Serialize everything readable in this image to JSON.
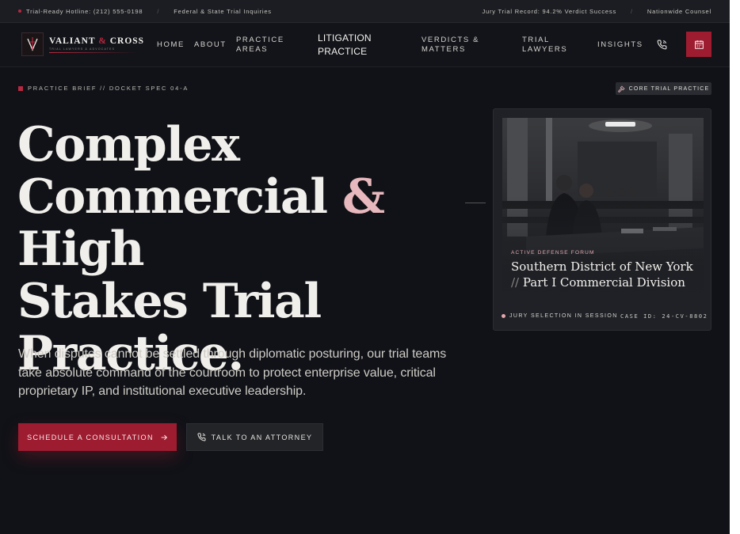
{
  "topbar": {
    "hotline": "Trial-Ready Hotline: (212) 555-0198",
    "inquiries": "Federal & State Trial Inquiries",
    "record": "Jury Trial Record: 94.2% Verdict Success",
    "counsel": "Nationwide Counsel",
    "separator": "/"
  },
  "brand": {
    "name_a": "VALIANT",
    "amp": " & ",
    "name_b": "CROSS",
    "tagline": "TRIAL LAWYERS & ADVOCATES"
  },
  "nav": {
    "home": "HOME",
    "about": "ABOUT",
    "practice_1": "PRACTICE",
    "practice_2": "AREAS",
    "litigation_1": "LITIGATION",
    "litigation_2": "PRACTICE",
    "verdicts_1": "VERDICTS &",
    "verdicts_2": "MATTERS",
    "lawyers_1": "TRIAL",
    "lawyers_2": "LAWYERS",
    "insights": "INSIGHTS",
    "phone_icon": "phone-icon",
    "calendar_icon": "calendar-icon"
  },
  "hero": {
    "brief": "PRACTICE BRIEF // DOCKET SPEC 04-A",
    "badge": "CORE TRIAL PRACTICE",
    "headline_1": "Complex",
    "headline_2a": "Commercial ",
    "headline_2b": "&",
    "headline_2c": " High",
    "headline_3": "Stakes Trial",
    "headline_4": "Practice.",
    "lede": "When disputes cannot be settled through diplomatic posturing, our trial teams take absolute command of the courtroom to protect enterprise value, critical proprietary IP, and institutional executive leadership.",
    "cta_primary": "SCHEDULE A CONSULTATION",
    "cta_secondary": "TALK TO AN ATTORNEY"
  },
  "card": {
    "forum": "ACTIVE DEFENSE FORUM",
    "court_1": "Southern District of New York",
    "court_slash": "// ",
    "court_2": "Part I Commercial Division",
    "session": "JURY SELECTION IN SESSION",
    "case_id": "CASE ID: 24-CV-8802"
  },
  "colors": {
    "accent": "#9e1c30",
    "accent_light": "#e7b8bd",
    "background": "#101217"
  }
}
